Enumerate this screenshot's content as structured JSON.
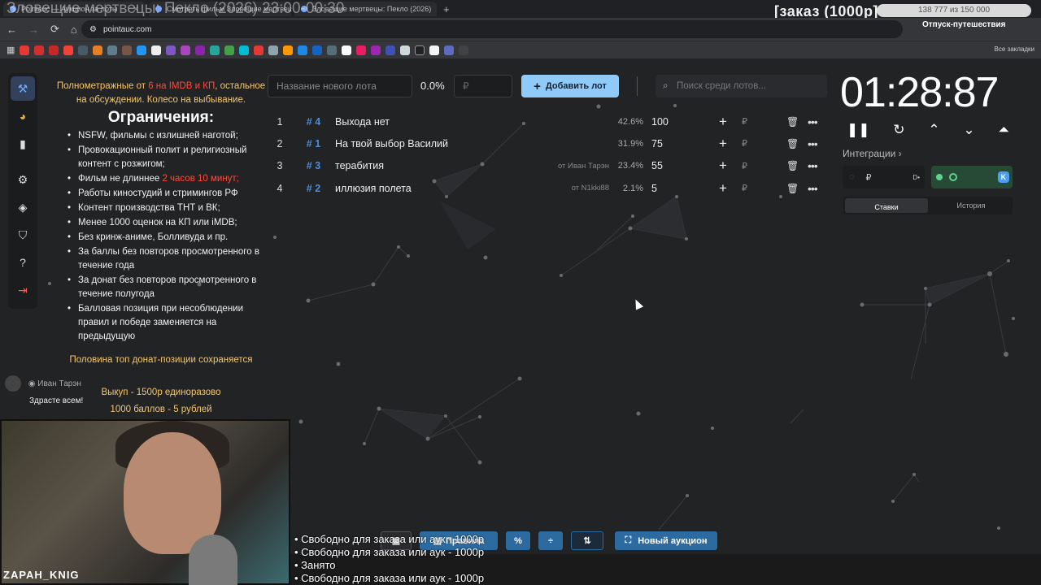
{
  "stream": {
    "title": "Зловещие мертвецы: Пекло (2026) 23:00-00:30",
    "order_label": "[заказ (1000р]",
    "goal_text": "138 777 из 150 000",
    "vacation_text": "Отпуск-путешествия",
    "cam_name": "ZAPAH_KNIG"
  },
  "browser": {
    "tabs": [
      "Pointauc — Аукцион за лоты",
      "Смотреть фильм Зловещие мертвецы",
      "Зловещие мертвецы: Пекло (2026)"
    ],
    "url": "pointauc.com",
    "all_bookmarks": "Все закладки"
  },
  "rules": {
    "intro_a": "Полнометражные от ",
    "intro_red": "6 на IMDB и КП",
    "intro_b": ", остальное на обсуждении. Колесо на выбывание.",
    "heading": "Ограничения:",
    "items": [
      "NSFW, фильмы с излишней наготой;",
      "Провокационный полит и религиозный контент с розжигом;",
      "Фильм не длиннее ",
      "Работы киностудий и стримингов РФ",
      "Контент производства ТНТ и ВК;",
      "Менее 1000 оценок на КП или iMDB;",
      "Без кринж-аниме, Болливуда и пр.",
      "За баллы без повторов просмотренного в течение года",
      "За донат без повторов просмотренного в течение полугода",
      "Балловая позиция при несоблюдении правил и победе заменяется на предыдущую"
    ],
    "duration_red": "2 часов 10 минут;",
    "note1": "Половина топ донат-позиции сохраняется",
    "note2": "Выкуп - 1500р единоразово",
    "note3": "1000 баллов - 5 рублей"
  },
  "chat": {
    "user": "Иван Тарэн",
    "message": "Здрасте всем!"
  },
  "lot_form": {
    "name_placeholder": "Название нового лота",
    "percent": "0.0%",
    "amount_placeholder": "₽",
    "add_label": "Добавить лот",
    "search_placeholder": "Поиск среди лотов..."
  },
  "lots": [
    {
      "idx": "1",
      "num": "# 4",
      "name": "Выхода нет",
      "from": "",
      "pct": "42.6%",
      "value": "100",
      "currency": "₽"
    },
    {
      "idx": "2",
      "num": "# 1",
      "name": "На твой выбор Василий",
      "from": "",
      "pct": "31.9%",
      "value": "75",
      "currency": "₽"
    },
    {
      "idx": "3",
      "num": "# 3",
      "name": "терабития",
      "from": "от Иван Тарэн",
      "pct": "23.4%",
      "value": "55",
      "currency": "₽"
    },
    {
      "idx": "4",
      "num": "# 2",
      "name": "иллюзия полета",
      "from": "от N1kki88",
      "pct": "2.1%",
      "value": "5",
      "currency": "₽"
    }
  ],
  "timer": {
    "value": "01:28:87",
    "integrations_label": "Интеграции",
    "panel_currency": "₽",
    "tabs": [
      "Ставки",
      "История"
    ]
  },
  "bottom": {
    "rules_label": "Правила",
    "new_auction_label": "Новый аукцион",
    "overlay_lines": [
      "• Свободно для заказа или аук - 1000р",
      "• Свободно для заказа или аук - 1000р",
      "• Занято",
      "• Свободно для заказа или аук - 1000р"
    ]
  },
  "colors": {
    "accent": "#90caf9",
    "lot_number": "#4b8fdc",
    "gold": "#f4c66b",
    "red": "#ff4a3d"
  }
}
